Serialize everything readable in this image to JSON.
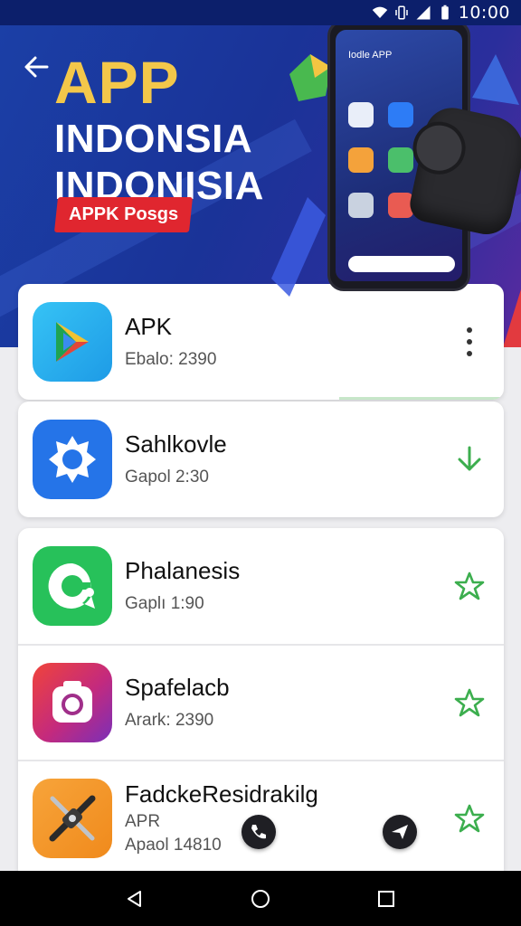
{
  "status_bar": {
    "time": "10:00",
    "icons": [
      "wifi-icon",
      "vibrate-icon",
      "signal-icon",
      "battery-icon"
    ]
  },
  "hero": {
    "title_line1": "APP",
    "title_line2": "INDONSIA",
    "title_line3": "INDONISIA",
    "badge": "APPK Posgs",
    "phone_label": "Iodle APP",
    "colors": {
      "title_accent": "#f3c74a",
      "badge": "#e0262f",
      "background": "#1b3fa6"
    }
  },
  "apps": [
    {
      "name": "APK",
      "sub": "Ebalo: 2390",
      "action": "more-vert-icon",
      "icon": "play-store-icon"
    },
    {
      "name": "Sahlkovle",
      "sub": "Gapol 2:30",
      "action": "download-icon",
      "icon": "gear-badge-icon"
    },
    {
      "name": "Phalanesis",
      "sub": "Gaplı 1:90",
      "action": "star-icon",
      "icon": "chat-bubble-icon"
    },
    {
      "name": "Spafelacb",
      "sub": "Arark: 2390",
      "action": "star-icon",
      "icon": "camera-icon"
    },
    {
      "name": "FadckeResidrakilg",
      "sub": "APR",
      "sub2": "Apaol 14810",
      "action": "star-icon",
      "icon": "tools-icon"
    }
  ],
  "accent_green": "#3cae4e",
  "nav": [
    "back-icon",
    "home-icon",
    "recents-icon"
  ]
}
